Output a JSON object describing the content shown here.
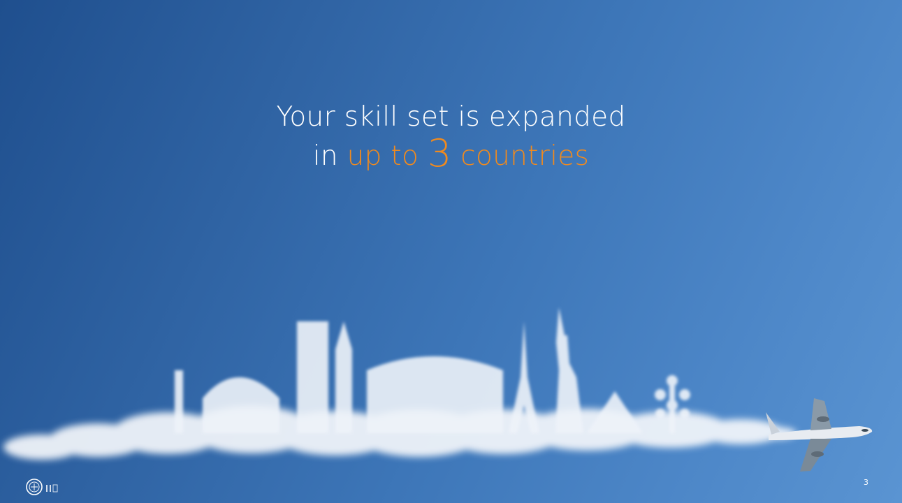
{
  "slide": {
    "title_line1": "Your skill set is expanded",
    "title_line2_prefix": "in ",
    "title_line2_accent_a": "up to ",
    "title_line2_number": "3",
    "title_line2_accent_b": " countries",
    "slide_number": "3"
  },
  "colors": {
    "accent": "#f08a1e",
    "title_text": "#ffffff",
    "background_top": "#1f4f8e",
    "background_bottom": "#5a94d2"
  },
  "icons": {
    "logo": "university-seal-icon",
    "airplane": "airplane-icon"
  }
}
